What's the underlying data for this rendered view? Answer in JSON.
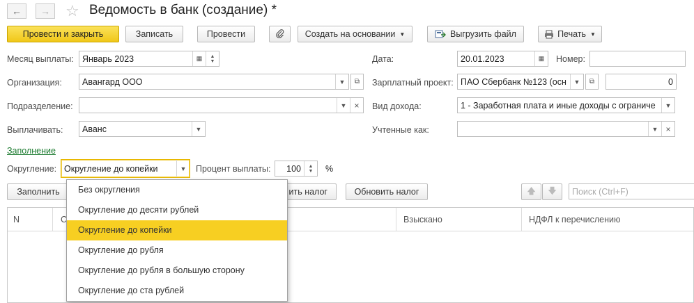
{
  "window": {
    "title": "Ведомость в банк (создание) *"
  },
  "toolbar": {
    "post_close": "Провести и закрыть",
    "save": "Записать",
    "post": "Провести",
    "create_based": "Создать на основании",
    "export_file": "Выгрузить файл",
    "print": "Печать"
  },
  "form": {
    "month_label": "Месяц выплаты:",
    "month_value": "Январь 2023",
    "date_label": "Дата:",
    "date_value": "20.01.2023",
    "number_label": "Номер:",
    "number_value": "",
    "org_label": "Организация:",
    "org_value": "Авангард ООО",
    "salary_project_label": "Зарплатный проект:",
    "salary_project_value": "ПАО Сбербанк №123 (осн",
    "salary_project_num": "0",
    "division_label": "Подразделение:",
    "division_value": "",
    "income_type_label": "Вид дохода:",
    "income_type_value": "1 - Заработная плата и иные доходы с ограниче",
    "pay_label": "Выплачивать:",
    "pay_value": "Аванс",
    "counted_as_label": "Учтенные как:",
    "counted_as_value": "",
    "fill_link": "Заполнение",
    "rounding_label": "Округление:",
    "rounding_value": "Округление до копейки",
    "percent_label": "Процент выплаты:",
    "percent_value": "100",
    "percent_unit": "%"
  },
  "table_toolbar": {
    "fill": "Заполнить",
    "calc_tax": "ить налог",
    "update_tax": "Обновить налог",
    "search_placeholder": "Поиск (Ctrl+F)"
  },
  "table": {
    "col_n": "N",
    "col_2": "С",
    "col_collected": "Взыскано",
    "col_ndfl": "НДФЛ к перечислению"
  },
  "dropdown": {
    "selected_index": 2,
    "items": [
      "Без округления",
      "Округление до десяти рублей",
      "Округление до копейки",
      "Округление до рубля",
      "Округление до рубля в большую сторону",
      "Округление до ста рублей"
    ]
  },
  "colors": {
    "primary": "#f0c718",
    "selected": "#f7cf22",
    "link": "#1a7a2e"
  }
}
